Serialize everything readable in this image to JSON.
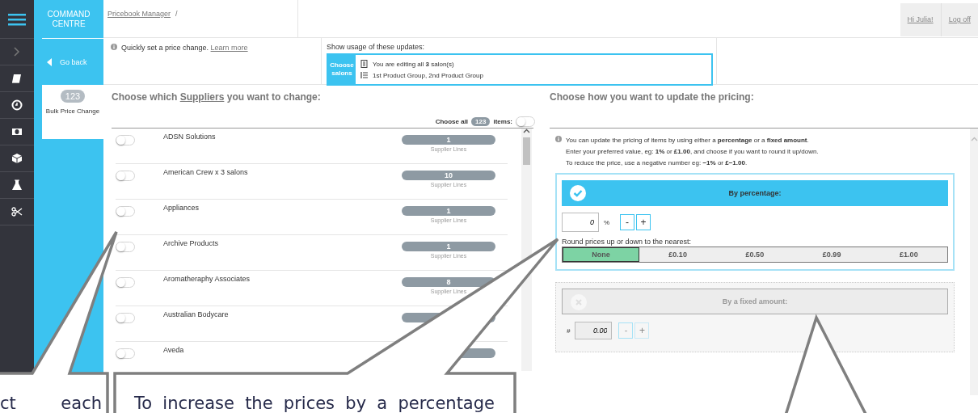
{
  "app_title": "COMMAND CENTRE",
  "breadcrumb": {
    "items": [
      "Pricebook Manager"
    ],
    "separator": "/"
  },
  "user": {
    "greeting": "Hi Julia!",
    "logout": "Log off"
  },
  "nav": {
    "back": "Go back",
    "count": "123",
    "label": "Bulk Price Change"
  },
  "info": {
    "text": "Quickly set a price change.",
    "link": "Learn more"
  },
  "usage": {
    "title": "Show usage of these updates:",
    "button": "Choose salons",
    "lines": [
      "You are editing all **3** salon(s)",
      "1st Product Group, 2nd Product Group"
    ]
  },
  "suppliers": {
    "heading_before": "Choose which",
    "heading_link": "Suppliers",
    "heading_after": "you want to change:",
    "choose_all": {
      "label": "Choose all",
      "count": "123",
      "suffix": "items:",
      "on": false
    },
    "rows": [
      {
        "name": "ADSN Solutions",
        "count": "1",
        "unit": "Supplier Lines",
        "on": false
      },
      {
        "name": "American Crew x 3 salons",
        "count": "10",
        "unit": "Supplier Lines",
        "on": false
      },
      {
        "name": "Appliances",
        "count": "1",
        "unit": "Supplier Lines",
        "on": false
      },
      {
        "name": "Archive Products",
        "count": "1",
        "unit": "Supplier Lines",
        "on": false
      },
      {
        "name": "Aromatheraphy Associates",
        "count": "8",
        "unit": "Supplier Lines",
        "on": false
      },
      {
        "name": "Australian Bodycare",
        "on": false
      },
      {
        "name": "Aveda",
        "on": false
      }
    ]
  },
  "pricing": {
    "heading": "Choose how you want to update the pricing:",
    "info": [
      "You can update the pricing of items by using either a **percentage** or a **fixed amount**.",
      "Enter your preferred value, eg: **1%** or **£1.00**, and choose if you want to round it up/down.",
      "To reduce the price, use a negative number eg: **−1%** or **£−1.00**."
    ],
    "options": [
      {
        "kind": "percentage",
        "title": "By percentage:",
        "selected": true,
        "symbol": "%",
        "value": "0",
        "minus": "-",
        "plus": "+",
        "round_label": "Round prices up or down to the nearest:",
        "rounding": [
          {
            "label": "None",
            "selected": true
          },
          {
            "label": "£0.10",
            "selected": false
          },
          {
            "label": "£0.50",
            "selected": false
          },
          {
            "label": "£0.99",
            "selected": false
          },
          {
            "label": "£1.00",
            "selected": false
          }
        ]
      },
      {
        "kind": "fixed",
        "title": "By a fixed amount:",
        "selected": false,
        "symbol": "#",
        "value": "0.00",
        "minus": "-",
        "plus": "+"
      }
    ]
  },
  "callouts": [
    {
      "text": "ct each"
    },
    {
      "text": "To increase the prices by a percentage"
    }
  ]
}
